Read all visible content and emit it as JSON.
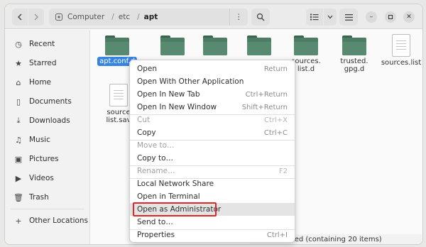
{
  "header": {
    "path": [
      "Computer",
      "etc",
      "apt"
    ],
    "icons": {
      "back": "chevron-left-icon",
      "forward": "chevron-right-icon",
      "search": "search-icon",
      "view": "list-view-icon",
      "menu": "hamburger-icon"
    }
  },
  "sidebar": {
    "items": [
      {
        "label": "Recent",
        "icon": "clock-icon"
      },
      {
        "label": "Starred",
        "icon": "star-icon"
      },
      {
        "label": "Home",
        "icon": "home-icon"
      },
      {
        "label": "Documents",
        "icon": "document-icon"
      },
      {
        "label": "Downloads",
        "icon": "download-icon"
      },
      {
        "label": "Music",
        "icon": "music-icon"
      },
      {
        "label": "Pictures",
        "icon": "picture-icon"
      },
      {
        "label": "Videos",
        "icon": "video-icon"
      },
      {
        "label": "Trash",
        "icon": "trash-icon"
      }
    ],
    "other_locations": "Other Locations"
  },
  "files": [
    {
      "name": "apt.conf.d",
      "kind": "folder",
      "selected": true
    },
    {
      "name": "",
      "kind": "folder"
    },
    {
      "name": "",
      "kind": "folder"
    },
    {
      "name": "",
      "kind": "folder"
    },
    {
      "name_lines": [
        "sources.",
        "list.d"
      ],
      "kind": "folder"
    },
    {
      "name_lines": [
        "trusted.",
        "gpg.d"
      ],
      "kind": "folder"
    },
    {
      "name": "sources.list",
      "kind": "file"
    },
    {
      "name_lines": [
        "source",
        "list.sav"
      ],
      "kind": "file"
    }
  ],
  "context_menu": {
    "items": [
      {
        "label": "Open",
        "shortcut": "Return"
      },
      {
        "label": "Open With Other Application",
        "shortcut": ""
      },
      {
        "label": "Open In New Tab",
        "shortcut": "Ctrl+Return"
      },
      {
        "label": "Open In New Window",
        "shortcut": "Shift+Return"
      },
      {
        "label": "Cut",
        "shortcut": "Ctrl+X",
        "disabled": true
      },
      {
        "label": "Copy",
        "shortcut": "Ctrl+C"
      },
      {
        "label": "Move to…",
        "shortcut": "",
        "disabled": true
      },
      {
        "label": "Copy to…",
        "shortcut": ""
      },
      {
        "label": "Rename…",
        "shortcut": "F2",
        "disabled": true
      },
      {
        "label": "Local Network Share",
        "shortcut": ""
      },
      {
        "label": "Open in Terminal",
        "shortcut": ""
      },
      {
        "label": "Open as Administrator",
        "shortcut": "",
        "highlighted": true
      },
      {
        "label": "Send to…",
        "shortcut": ""
      },
      {
        "label": "Properties",
        "shortcut": "Ctrl+I"
      }
    ]
  },
  "status": "nf.d” selected  (containing 20 items)",
  "colors": {
    "selection": "#3584e4",
    "folder": "#4c7c64",
    "highlight_border": "#e02828"
  }
}
